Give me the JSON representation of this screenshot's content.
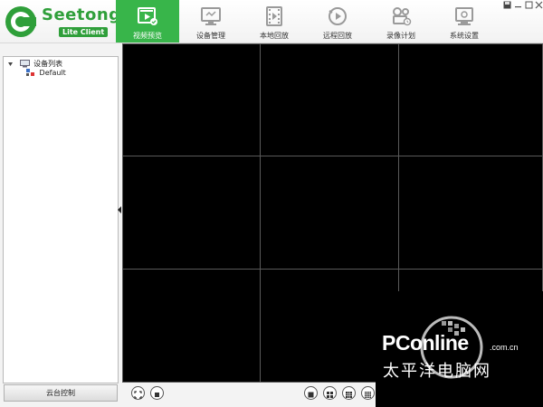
{
  "app": {
    "brand": "Seetong",
    "badge": "Lite Client",
    "accent_color": "#38b54a"
  },
  "toolbar": {
    "tabs": [
      {
        "label": "视频预览",
        "icon": "video-preview-icon",
        "active": true
      },
      {
        "label": "设备管理",
        "icon": "device-manage-icon",
        "active": false
      },
      {
        "label": "本地回放",
        "icon": "local-playback-icon",
        "active": false
      },
      {
        "label": "远程回放",
        "icon": "remote-playback-icon",
        "active": false
      },
      {
        "label": "录像计划",
        "icon": "record-plan-icon",
        "active": false
      },
      {
        "label": "系统设置",
        "icon": "system-settings-icon",
        "active": false
      }
    ]
  },
  "window_controls": [
    "save-icon",
    "minimize-icon",
    "maximize-icon",
    "close-icon"
  ],
  "sidebar": {
    "tree_root": "设备列表",
    "tree_child": "Default",
    "ptz_button": "云台控制"
  },
  "video_grid": {
    "rows": 3,
    "cols": 3
  },
  "watermark": {
    "brand": "PConline",
    "domain": ".com.cn",
    "subtitle": "太平洋电脑网"
  }
}
